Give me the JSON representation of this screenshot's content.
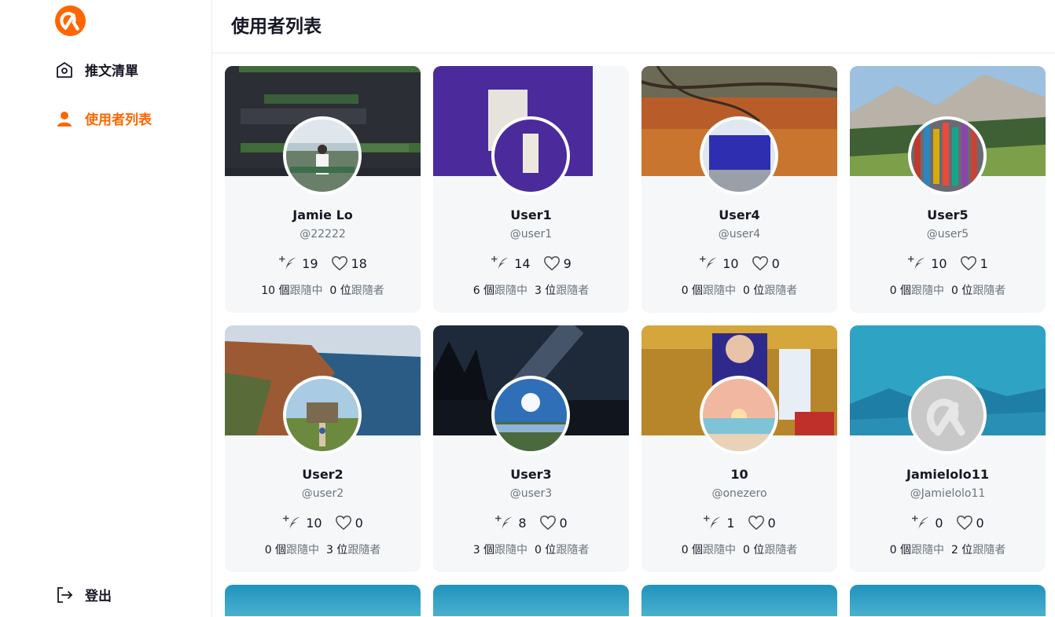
{
  "sidebar": {
    "nav_home": "推文清單",
    "nav_users": "使用者列表",
    "nav_logout": "登出",
    "accent_color": "#ff6600"
  },
  "header": {
    "title": "使用者列表"
  },
  "users": [
    {
      "name": "Jamie Lo",
      "handle": "@22222",
      "tweets": "19",
      "likes": "18",
      "following_count": "10 個",
      "following_label": "跟隨中",
      "followers_count": "0 位",
      "followers_label": "跟隨者"
    },
    {
      "name": "User1",
      "handle": "@user1",
      "tweets": "14",
      "likes": "9",
      "following_count": "6 個",
      "following_label": "跟隨中",
      "followers_count": "3 位",
      "followers_label": "跟隨者"
    },
    {
      "name": "User4",
      "handle": "@user4",
      "tweets": "10",
      "likes": "0",
      "following_count": "0 個",
      "following_label": "跟隨中",
      "followers_count": "0 位",
      "followers_label": "跟隨者"
    },
    {
      "name": "User5",
      "handle": "@user5",
      "tweets": "10",
      "likes": "1",
      "following_count": "0 個",
      "following_label": "跟隨中",
      "followers_count": "0 位",
      "followers_label": "跟隨者"
    },
    {
      "name": "User2",
      "handle": "@user2",
      "tweets": "10",
      "likes": "0",
      "following_count": "0 個",
      "following_label": "跟隨中",
      "followers_count": "3 位",
      "followers_label": "跟隨者"
    },
    {
      "name": "User3",
      "handle": "@user3",
      "tweets": "8",
      "likes": "0",
      "following_count": "3 個",
      "following_label": "跟隨中",
      "followers_count": "0 位",
      "followers_label": "跟隨者"
    },
    {
      "name": "10",
      "handle": "@onezero",
      "tweets": "1",
      "likes": "0",
      "following_count": "0 個",
      "following_label": "跟隨中",
      "followers_count": "0 位",
      "followers_label": "跟隨者"
    },
    {
      "name": "Jamielolo11",
      "handle": "@Jamielolo11",
      "tweets": "0",
      "likes": "0",
      "following_count": "0 個",
      "following_label": "跟隨中",
      "followers_count": "2 位",
      "followers_label": "跟隨者"
    }
  ]
}
